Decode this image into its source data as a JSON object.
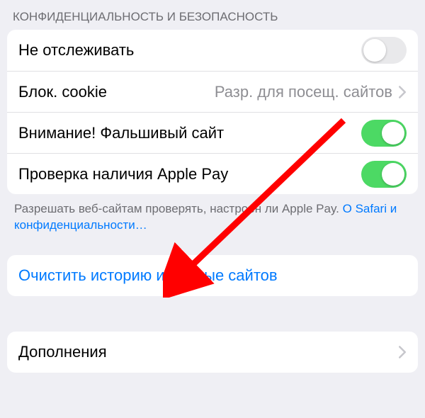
{
  "section": {
    "header": "КОНФИДЕНЦИАЛЬНОСТЬ И БЕЗОПАСНОСТЬ",
    "rows": {
      "do_not_track": {
        "label": "Не отслеживать",
        "on": false
      },
      "block_cookie": {
        "label": "Блок. cookie",
        "value": "Разр. для посещ. сайтов"
      },
      "fraud_warning": {
        "label": "Внимание! Фальшивый сайт",
        "on": true
      },
      "apple_pay_check": {
        "label": "Проверка наличия Apple Pay",
        "on": true
      }
    },
    "footer_text": "Разрешать веб-сайтам проверять, настроен ли Apple Pay. ",
    "footer_link": "О Safari и конфиденциальности…"
  },
  "clear_action": {
    "label": "Очистить историю и данные сайтов"
  },
  "addons": {
    "label": "Дополнения"
  }
}
